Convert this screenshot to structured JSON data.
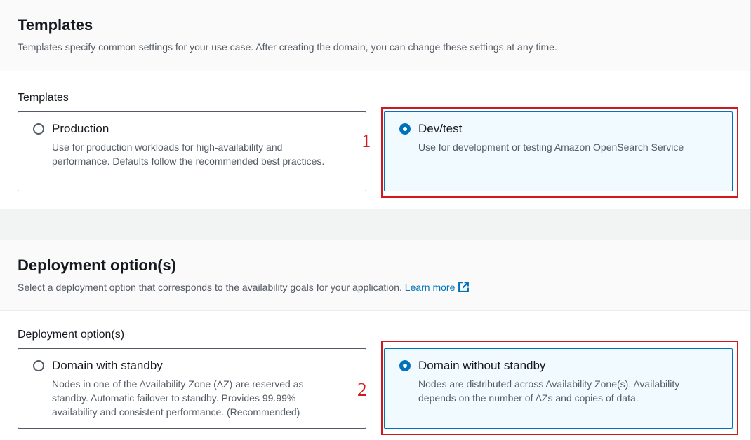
{
  "templates": {
    "title": "Templates",
    "description": "Templates specify common settings for your use case. After creating the domain, you can change these settings at any time.",
    "field_label": "Templates",
    "options": [
      {
        "label": "Production",
        "description": "Use for production workloads for high-availability and performance. Defaults follow the recommended best practices.",
        "selected": false
      },
      {
        "label": "Dev/test",
        "description": "Use for development or testing Amazon OpenSearch Service",
        "selected": true
      }
    ],
    "annotation": "1"
  },
  "deployment": {
    "title": "Deployment option(s)",
    "description": "Select a deployment option that corresponds to the availability goals for your application.",
    "learn_more": "Learn more",
    "learn_more_icon": "external-link-icon",
    "field_label": "Deployment option(s)",
    "options": [
      {
        "label": "Domain with standby",
        "description": "Nodes in one of the Availability Zone (AZ) are reserved as standby. Automatic failover to standby. Provides 99.99% availability and consistent performance. (Recommended)",
        "selected": false
      },
      {
        "label": "Domain without standby",
        "description": "Nodes are distributed across Availability Zone(s). Availability depends on the number of AZs and copies of data.",
        "selected": true
      }
    ],
    "annotation": "2"
  },
  "colors": {
    "accent": "#0073bb",
    "selected_bg": "#f1faff",
    "annotation_red": "#d0181e",
    "page_bg": "#f2f3f3"
  }
}
